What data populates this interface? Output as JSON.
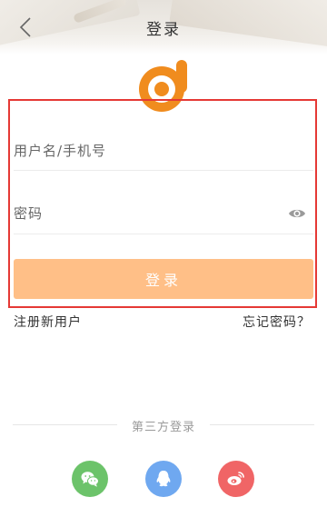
{
  "header": {
    "title": "登录",
    "back_icon": "chevron-left-icon"
  },
  "form": {
    "username_placeholder": "用户名/手机号",
    "password_placeholder": "密码",
    "password_toggle_icon": "eye-icon",
    "login_label": "登录",
    "login_color": "#ffbf87"
  },
  "links": {
    "register": "注册新用户",
    "forgot": "忘记密码？"
  },
  "third_party": {
    "label": "第三方登录",
    "providers": [
      {
        "name": "wechat",
        "icon": "wechat-icon",
        "color": "#6cc36a"
      },
      {
        "name": "qq",
        "icon": "qq-icon",
        "color": "#6fa8f0"
      },
      {
        "name": "weibo",
        "icon": "weibo-icon",
        "color": "#f06566"
      }
    ]
  },
  "colors": {
    "brand": "#f08c1e",
    "highlight_border": "#e53935"
  }
}
